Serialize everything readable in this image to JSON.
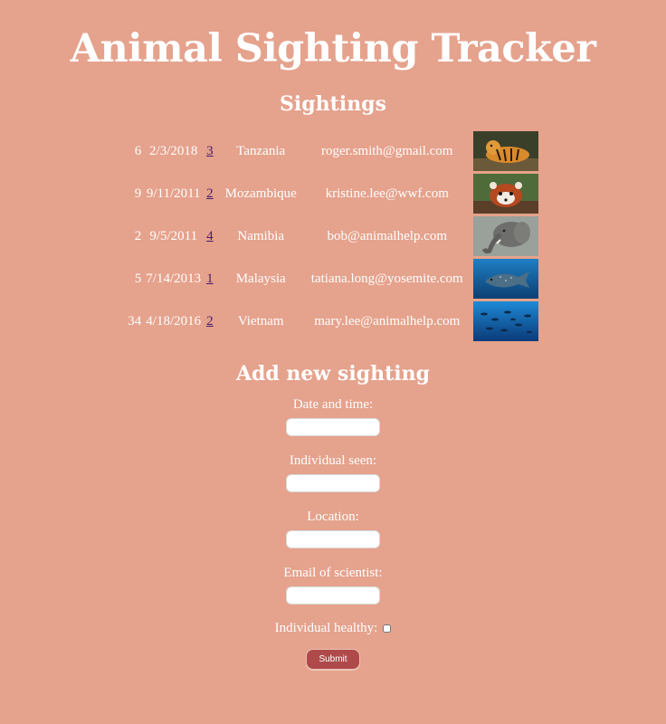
{
  "page": {
    "title": "Animal Sighting Tracker"
  },
  "sightings": {
    "heading": "Sightings",
    "rows": [
      {
        "id": "6",
        "date": "2/3/2018",
        "individual": "3",
        "location": "Tanzania",
        "email": "roger.smith@gmail.com",
        "image": "tiger"
      },
      {
        "id": "9",
        "date": "9/11/2011",
        "individual": "2",
        "location": "Mozambique",
        "email": "kristine.lee@wwf.com",
        "image": "red-panda"
      },
      {
        "id": "2",
        "date": "9/5/2011",
        "individual": "4",
        "location": "Namibia",
        "email": "bob@animalhelp.com",
        "image": "elephant"
      },
      {
        "id": "5",
        "date": "7/14/2013",
        "individual": "1",
        "location": "Malaysia",
        "email": "tatiana.long@yosemite.com",
        "image": "whale-shark"
      },
      {
        "id": "34",
        "date": "4/18/2016",
        "individual": "2",
        "location": "Vietnam",
        "email": "mary.lee@animalhelp.com",
        "image": "fish-school"
      }
    ]
  },
  "form": {
    "heading": "Add new sighting",
    "date_label": "Date and time:",
    "individual_label": "Individual seen:",
    "location_label": "Location:",
    "email_label": "Email of scientist:",
    "healthy_label": "Individual healthy:",
    "submit_label": "Submit"
  },
  "colors": {
    "background": "#e5a28c",
    "text": "#ffffff",
    "submit": "#b04a4a",
    "link": "#4b1c6e"
  }
}
